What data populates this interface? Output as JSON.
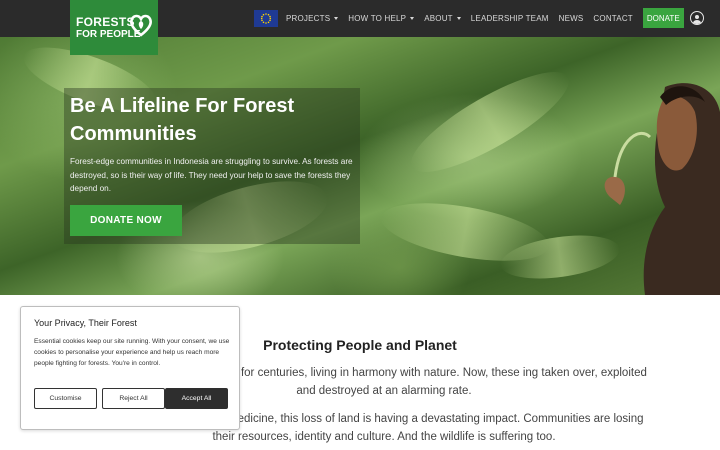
{
  "header": {
    "logo": {
      "line1": "FORESTS",
      "line2": "FOR PEOPLE"
    },
    "nav": {
      "items": [
        {
          "label": "PROJECTS",
          "dropdown": true
        },
        {
          "label": "HOW TO HELP",
          "dropdown": true
        },
        {
          "label": "ABOUT",
          "dropdown": true
        },
        {
          "label": "LEADERSHIP TEAM",
          "dropdown": false
        },
        {
          "label": "NEWS",
          "dropdown": false
        },
        {
          "label": "CONTACT",
          "dropdown": false
        }
      ],
      "donate_label": "DONATE",
      "flag_icon": "eu-flag-icon",
      "account_icon": "user-icon"
    }
  },
  "hero": {
    "title": "Be A Lifeline For Forest Communities",
    "text": "Forest-edge communities in Indonesia are struggling to survive. As forests are destroyed, so is their way of life. They need your help to save the forests they depend on.",
    "button_label": "DONATE NOW"
  },
  "main": {
    "title": "Protecting People and Planet",
    "paragraph1": "ted Indonesia's jungles for centuries, living in harmony with nature. Now, these ing taken over, exploited and destroyed at an alarming rate.",
    "paragraph2": "ed, shelter, fuel and medicine, this loss of land is having a devastating impact. Communities are losing their resources, identity and culture. And the wildlife is suffering too."
  },
  "cookie": {
    "title": "Your Privacy, Their Forest",
    "text": "Essential cookies keep our site running. With your consent, we use cookies to personalise your experience and help us reach more people fighting for forests. You're in control.",
    "buttons": {
      "customise": "Customise",
      "reject": "Reject All",
      "accept": "Accept All"
    }
  },
  "colors": {
    "brand_green": "#2e8b3a",
    "donate_green": "#3aa53f",
    "header_bg": "#2b2b2b",
    "eu_blue": "#1f3a93"
  }
}
